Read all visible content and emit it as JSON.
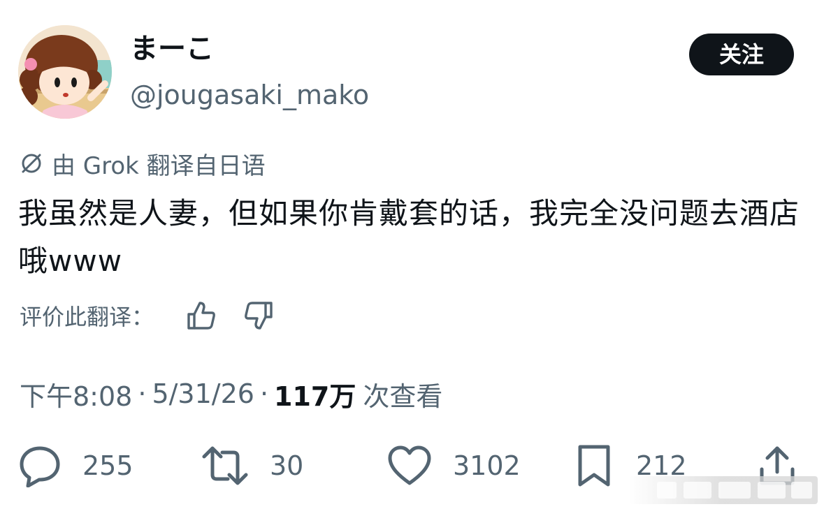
{
  "header": {
    "display_name": "まーこ",
    "handle": "@jougasaki_mako",
    "follow_label": "关注"
  },
  "translation": {
    "label": "由 Grok 翻译自日语",
    "icon": "grok-icon"
  },
  "tweet": {
    "text": "我虽然是人妻，但如果你肯戴套的话，我完全没问题去酒店哦www"
  },
  "rate": {
    "label": "评价此翻译：",
    "up_icon": "thumbs-up-icon",
    "down_icon": "thumbs-down-icon"
  },
  "meta": {
    "time": "下午8:08",
    "separator": "·",
    "date": "5/31/26",
    "views_count": "117万",
    "views_label": "次查看"
  },
  "actions": {
    "reply_count": "255",
    "retweet_count": "30",
    "like_count": "3102",
    "bookmark_count": "212"
  },
  "colors": {
    "text_primary": "#0f1419",
    "text_secondary": "#536471",
    "button_bg": "#0f1419",
    "background": "#ffffff"
  }
}
